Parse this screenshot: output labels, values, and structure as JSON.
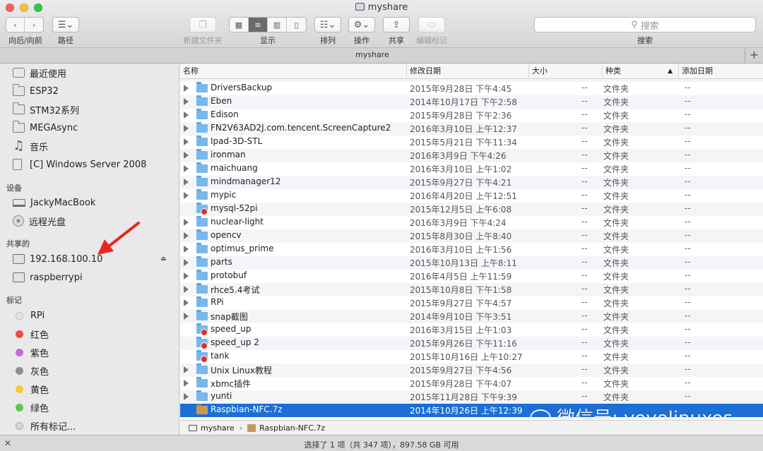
{
  "window": {
    "title": "myshare",
    "traffic_colors": [
      "#fc605c",
      "#fdbc40",
      "#34c84a"
    ]
  },
  "toolbar": {
    "nav_label": "向后/向前",
    "path_label": "路径",
    "new_folder_label": "新建文件夹",
    "view_label": "显示",
    "arrange_label": "排列",
    "action_label": "操作",
    "share_label": "共享",
    "tags_label": "编辑标记",
    "search_placeholder": "搜索",
    "search_label": "搜索"
  },
  "tab": {
    "name": "myshare",
    "add": "+"
  },
  "sidebar": {
    "favorites": [
      {
        "label": "最近使用",
        "icon": "recents-icon"
      },
      {
        "label": "ESP32",
        "icon": "folder-icon"
      },
      {
        "label": "STM32系列",
        "icon": "folder-icon"
      },
      {
        "label": "MEGAsync",
        "icon": "folder-icon"
      },
      {
        "label": "音乐",
        "icon": "music-icon"
      },
      {
        "label": "[C] Windows Server 2008",
        "icon": "document-icon"
      }
    ],
    "devices_header": "设备",
    "devices": [
      {
        "label": "JackyMacBook",
        "icon": "laptop-icon"
      },
      {
        "label": "远程光盘",
        "icon": "disc-icon"
      }
    ],
    "shared_header": "共享的",
    "shared": [
      {
        "label": "192.168.100.10",
        "icon": "monitor-icon"
      },
      {
        "label": "raspberrypi",
        "icon": "monitor-icon"
      }
    ],
    "tags_header": "标记",
    "tags": [
      {
        "label": "RPi",
        "color": "#e3e3e3"
      },
      {
        "label": "红色",
        "color": "#f2494b"
      },
      {
        "label": "紫色",
        "color": "#c46ad8"
      },
      {
        "label": "灰色",
        "color": "#8e8e93"
      },
      {
        "label": "黄色",
        "color": "#f7ca33"
      },
      {
        "label": "绿色",
        "color": "#61c553"
      },
      {
        "label": "所有标记...",
        "color": "#d6d6d6"
      }
    ],
    "annotation_arrow_color": "#e8271f"
  },
  "columns": {
    "name": "名称",
    "date": "修改日期",
    "size": "大小",
    "kind": "种类",
    "added": "添加日期"
  },
  "files": [
    {
      "name": "DriversBackup",
      "date": "2015年9月28日 下午4:45",
      "size": "--",
      "kind": "文件夹",
      "added": "--",
      "icon": "folder-icon",
      "expandable": true
    },
    {
      "name": "Eben",
      "date": "2014年10月17日 下午2:58",
      "size": "--",
      "kind": "文件夹",
      "added": "--",
      "icon": "folder-icon",
      "expandable": true
    },
    {
      "name": "Edison",
      "date": "2015年9月28日 下午2:36",
      "size": "--",
      "kind": "文件夹",
      "added": "--",
      "icon": "folder-icon",
      "expandable": true
    },
    {
      "name": "FN2V63AD2J.com.tencent.ScreenCapture2",
      "date": "2016年3月10日 上午12:37",
      "size": "--",
      "kind": "文件夹",
      "added": "--",
      "icon": "folder-icon",
      "expandable": true
    },
    {
      "name": "Ipad-3D-STL",
      "date": "2015年5月21日 下午11:34",
      "size": "--",
      "kind": "文件夹",
      "added": "--",
      "icon": "folder-icon",
      "expandable": true
    },
    {
      "name": "ironman",
      "date": "2016年3月9日 下午4:26",
      "size": "--",
      "kind": "文件夹",
      "added": "--",
      "icon": "folder-icon",
      "expandable": true
    },
    {
      "name": "maichuang",
      "date": "2016年3月10日 上午1:02",
      "size": "--",
      "kind": "文件夹",
      "added": "--",
      "icon": "folder-icon",
      "expandable": true
    },
    {
      "name": "mindmanager12",
      "date": "2015年9月27日 下午4:21",
      "size": "--",
      "kind": "文件夹",
      "added": "--",
      "icon": "folder-icon",
      "expandable": true
    },
    {
      "name": "mypic",
      "date": "2016年4月20日 上午12:51",
      "size": "--",
      "kind": "文件夹",
      "added": "--",
      "icon": "folder-icon",
      "expandable": true
    },
    {
      "name": "mysql-52pi",
      "date": "2015年12月5日 上午6:08",
      "size": "--",
      "kind": "文件夹",
      "added": "--",
      "icon": "locked-folder-icon",
      "expandable": false
    },
    {
      "name": "nuclear-light",
      "date": "2016年3月9日 下午4:24",
      "size": "--",
      "kind": "文件夹",
      "added": "--",
      "icon": "folder-icon",
      "expandable": true
    },
    {
      "name": "opencv",
      "date": "2015年8月30日 上午8:40",
      "size": "--",
      "kind": "文件夹",
      "added": "--",
      "icon": "folder-icon",
      "expandable": true
    },
    {
      "name": "optimus_prime",
      "date": "2016年3月10日 上午1:56",
      "size": "--",
      "kind": "文件夹",
      "added": "--",
      "icon": "folder-icon",
      "expandable": true
    },
    {
      "name": "parts",
      "date": "2015年10月13日 上午8:11",
      "size": "--",
      "kind": "文件夹",
      "added": "--",
      "icon": "folder-icon",
      "expandable": true
    },
    {
      "name": "protobuf",
      "date": "2016年4月5日 上午11:59",
      "size": "--",
      "kind": "文件夹",
      "added": "--",
      "icon": "folder-icon",
      "expandable": true
    },
    {
      "name": "rhce5.4考试",
      "date": "2015年10月8日 下午1:58",
      "size": "--",
      "kind": "文件夹",
      "added": "--",
      "icon": "folder-icon",
      "expandable": true
    },
    {
      "name": "RPi",
      "date": "2015年9月27日 下午4:57",
      "size": "--",
      "kind": "文件夹",
      "added": "--",
      "icon": "folder-icon",
      "expandable": true
    },
    {
      "name": "snap截图",
      "date": "2014年9月10日 下午3:51",
      "size": "--",
      "kind": "文件夹",
      "added": "--",
      "icon": "folder-icon",
      "expandable": true
    },
    {
      "name": "speed_up",
      "date": "2016年3月15日 上午1:03",
      "size": "--",
      "kind": "文件夹",
      "added": "--",
      "icon": "locked-folder-icon",
      "expandable": false
    },
    {
      "name": "speed_up 2",
      "date": "2015年9月26日 下午11:16",
      "size": "--",
      "kind": "文件夹",
      "added": "--",
      "icon": "locked-folder-icon",
      "expandable": false
    },
    {
      "name": "tank",
      "date": "2015年10月16日 上午10:27",
      "size": "--",
      "kind": "文件夹",
      "added": "--",
      "icon": "locked-folder-icon",
      "expandable": false
    },
    {
      "name": "Unix Linux教程",
      "date": "2015年9月27日 下午4:56",
      "size": "--",
      "kind": "文件夹",
      "added": "--",
      "icon": "folder-icon",
      "expandable": true
    },
    {
      "name": "xbmc插件",
      "date": "2015年9月28日 下午4:07",
      "size": "--",
      "kind": "文件夹",
      "added": "--",
      "icon": "folder-icon",
      "expandable": true
    },
    {
      "name": "yunti",
      "date": "2015年11月28日 下午9:39",
      "size": "--",
      "kind": "文件夹",
      "added": "--",
      "icon": "folder-icon",
      "expandable": true
    },
    {
      "name": "Raspbian-NFC.7z",
      "date": "2014年10月26日 上午12:39",
      "size": "",
      "kind": "",
      "added": "",
      "icon": "archive-icon",
      "expandable": false,
      "selected": true
    }
  ],
  "pathbar": {
    "root": "myshare",
    "file": "Raspbian-NFC.7z"
  },
  "status": {
    "text": "选择了 1 项（共 347 项），897.58 GB 可用"
  },
  "watermark": {
    "text": "微信号: yoyolinuxos"
  }
}
